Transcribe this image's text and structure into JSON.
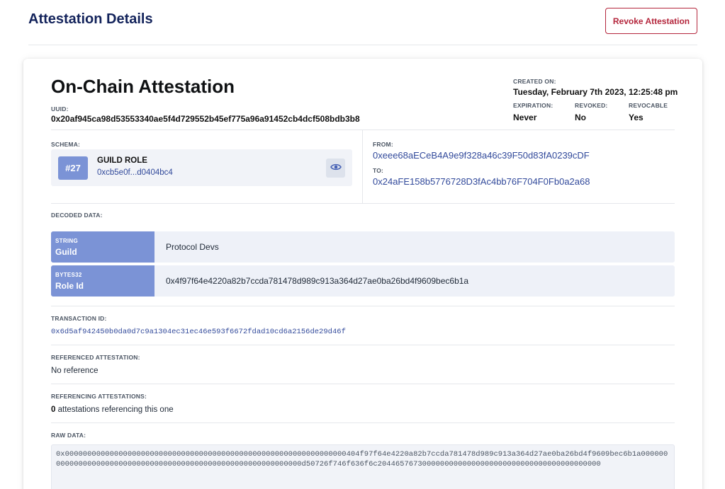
{
  "header": {
    "title": "Attestation Details",
    "revoke_label": "Revoke Attestation"
  },
  "attestation": {
    "title": "On-Chain Attestation",
    "uuid_label": "UUID:",
    "uuid": "0x20af945ca98d53553340ae5f4d729552b45ef775a96a91452cb4dcf508bdb3b8",
    "created_label": "CREATED ON:",
    "created": "Tuesday, February 7th 2023, 12:25:48 pm",
    "expiration_label": "EXPIRATION:",
    "expiration": "Never",
    "revoked_label": "REVOKED:",
    "revoked": "No",
    "revocable_label": "REVOCABLE",
    "revocable": "Yes"
  },
  "schema": {
    "label": "SCHEMA:",
    "number": "#27",
    "name": "GUILD ROLE",
    "uid_short": "0xcb5e0f...d0404bc4",
    "view_icon": "eye-icon"
  },
  "parties": {
    "from_label": "FROM:",
    "from": "0xeee68aECeB4A9e9f328a46c39F50d83fA0239cDF",
    "to_label": "TO:",
    "to": "0x24aFE158b5776728D3fAc4bb76F704F0Fb0a2a68"
  },
  "decoded": {
    "label": "DECODED DATA:",
    "rows": [
      {
        "type": "STRING",
        "name": "Guild",
        "value": "Protocol Devs"
      },
      {
        "type": "BYTES32",
        "name": "Role Id",
        "value": "0x4f97f64e4220a82b7ccda781478d989c913a364d27ae0ba26bd4f9609bec6b1a"
      }
    ]
  },
  "transaction": {
    "label": "TRANSACTION ID:",
    "id": "0x6d5af942450b0da0d7c9a1304ec31ec46e593f6672fdad10cd6a2156de29d46f"
  },
  "referenced": {
    "label": "REFERENCED ATTESTATION:",
    "value": "No reference"
  },
  "referencing": {
    "label": "REFERENCING ATTESTATIONS:",
    "count": "0",
    "suffix": " attestations referencing this one"
  },
  "raw": {
    "label": "RAW DATA:",
    "value": "0x000000000000000000000000000000000000000000000000000000000000000404f97f64e4220a82b7ccda781478d989c913a364d27ae0ba26bd4f9609bec6b1a0000000000000000000000000000000000000000000000000000000000000d50726f746f636f6c20446576730000000000000000000000000000000000000000"
  },
  "colors": {
    "accent": "#7b93d6",
    "link": "#324a9b",
    "danger": "#b4263c",
    "title": "#13235b"
  }
}
